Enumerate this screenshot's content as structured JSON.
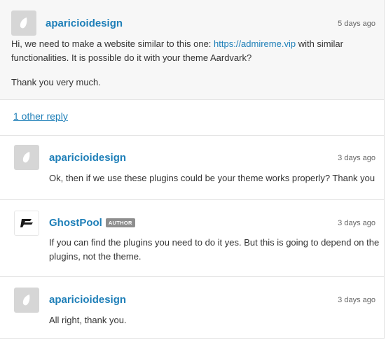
{
  "comments": [
    {
      "author": "aparicioidesign",
      "time": "5 days ago",
      "body_line1_pre": "Hi, we need to make a website similar to this one: ",
      "body_link": "https://admireme.vip",
      "body_line1_post": " with similar",
      "body_line2": "functionalities. It is possible do it with your theme Aardvark?",
      "body_para2": "Thank you very much.",
      "avatar_icon": "envato-leaf-icon"
    }
  ],
  "more_replies_label": "1 other reply",
  "replies": [
    {
      "author": "aparicioidesign",
      "time": "3 days ago",
      "body_line1": "Ok, then if we use these plugins could be your theme works properly? Thank you",
      "avatar_icon": "envato-leaf-icon"
    },
    {
      "author": "GhostPool",
      "badge": "AUTHOR",
      "time": "3 days ago",
      "body_line1": "If you can find the plugins you need to do it yes. But this is going to depend on the",
      "body_line2": "plugins, not the theme.",
      "avatar_icon": "ghostpool-logo-icon"
    },
    {
      "author": "aparicioidesign",
      "time": "3 days ago",
      "body_line1": "All right, thank you.",
      "avatar_icon": "envato-leaf-icon"
    }
  ],
  "colors": {
    "link": "#1e7fb8",
    "top_bg": "#f7f7f7",
    "badge_bg": "#8e8e8e"
  }
}
